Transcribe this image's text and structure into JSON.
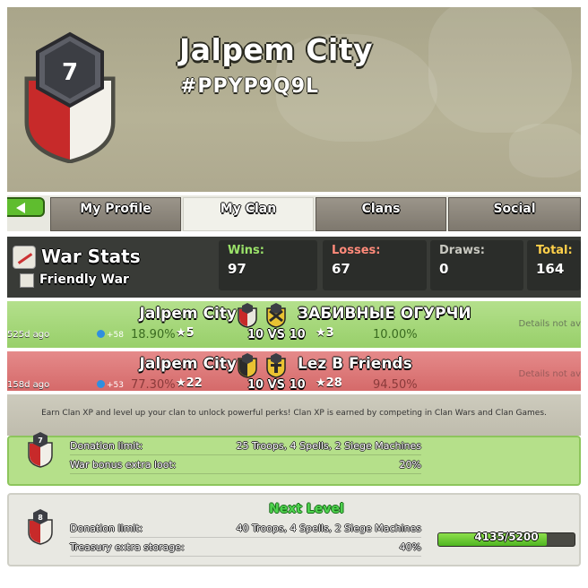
{
  "header": {
    "clan_name": "Jalpem City",
    "clan_tag": "#PPYP9Q9L",
    "clan_level": "7"
  },
  "tabs": [
    {
      "label": "My Profile",
      "active": false
    },
    {
      "label": "My Clan",
      "active": true
    },
    {
      "label": "Clans",
      "active": false
    },
    {
      "label": "Social",
      "active": false
    }
  ],
  "war_stats": {
    "title": "War Stats",
    "friendly_war_label": "Friendly War",
    "wins_label": "Wins:",
    "wins": "97",
    "losses_label": "Losses:",
    "losses": "67",
    "draws_label": "Draws:",
    "draws": "0",
    "total_label": "Total:",
    "total": "164"
  },
  "wars": [
    {
      "result": "win",
      "clan": "Jalpem City",
      "opponent": "ЗАБИВНЫЕ ОГУРЧИ",
      "ago": "525d ago",
      "xp": "+58",
      "our_pct": "18.90%",
      "our_stars": "5",
      "vs": "10 VS 10",
      "their_stars": "3",
      "their_pct": "10.00%",
      "details": "Details not av",
      "opponent_badge_level": "2"
    },
    {
      "result": "loss",
      "clan": "Jalpem City",
      "opponent": "Lez B Friends",
      "ago": "158d ago",
      "xp": "+53",
      "our_pct": "77.30%",
      "our_stars": "22",
      "vs": "10 VS 10",
      "their_stars": "28",
      "their_pct": "94.50%",
      "details": "Details not av",
      "opponent_badge_level": "7"
    }
  ],
  "perks": {
    "banner_text": "Earn Clan XP and level up your clan to unlock powerful perks! Clan XP is earned by competing in Clan Wars and Clan Games.",
    "current": {
      "level": "7",
      "rows": [
        {
          "label": "Donation limit:",
          "value": "25 Troops, 4 Spells, 2 Siege Machines"
        },
        {
          "label": "War bonus extra loot:",
          "value": "20%"
        }
      ]
    },
    "next": {
      "title": "Next Level",
      "level": "8",
      "rows": [
        {
          "label": "Donation limit:",
          "value": "40 Troops, 4 Spells, 2 Siege Machines"
        },
        {
          "label": "Treasury extra storage:",
          "value": "40%"
        }
      ],
      "xp_text": "4135/5200",
      "xp_current": 4135,
      "xp_max": 5200
    }
  },
  "colors": {
    "win_row": "#a8d97a",
    "loss_row": "#de7a7a",
    "wins_label": "#9be36a",
    "losses_label": "#ff8a7a",
    "draws_label": "#c8c8c0",
    "total_label": "#ffd04a"
  }
}
